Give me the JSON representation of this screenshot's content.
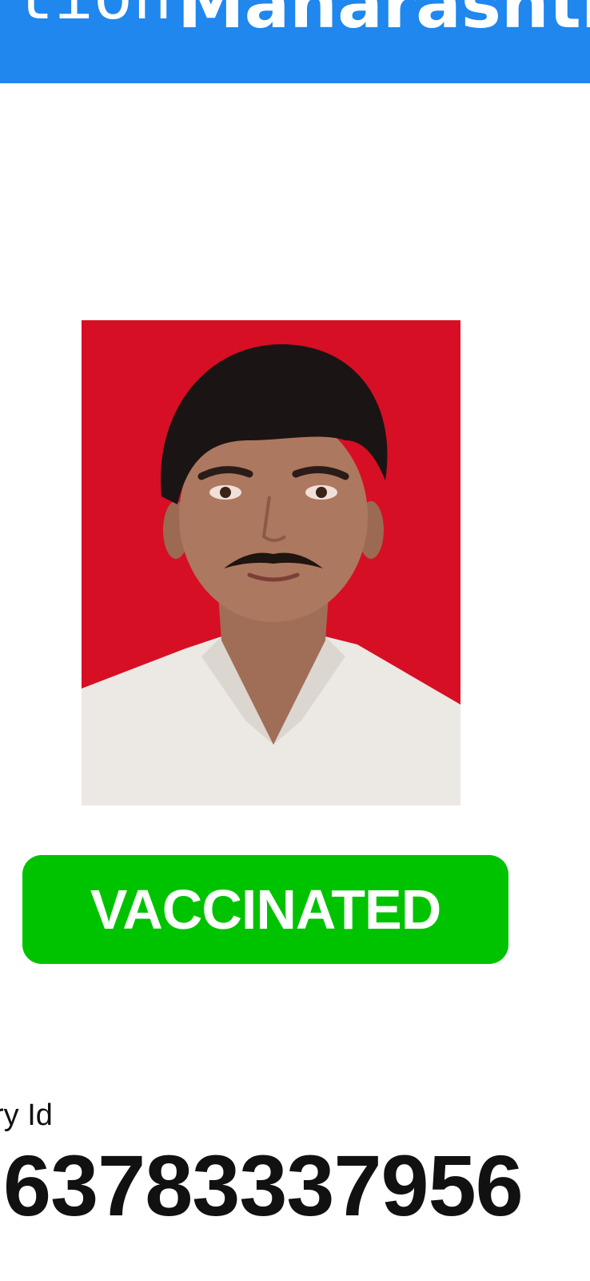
{
  "header": {
    "title_left": "tion",
    "title_right": "Maharashtra"
  },
  "profile": {
    "photo_background_color": "#d60f24"
  },
  "status": {
    "label": "VACCINATED",
    "color": "#00c300"
  },
  "beneficiary": {
    "label": "ry Id",
    "id_value": "63783337956"
  },
  "colors": {
    "header_accent": "#1f87ee"
  }
}
